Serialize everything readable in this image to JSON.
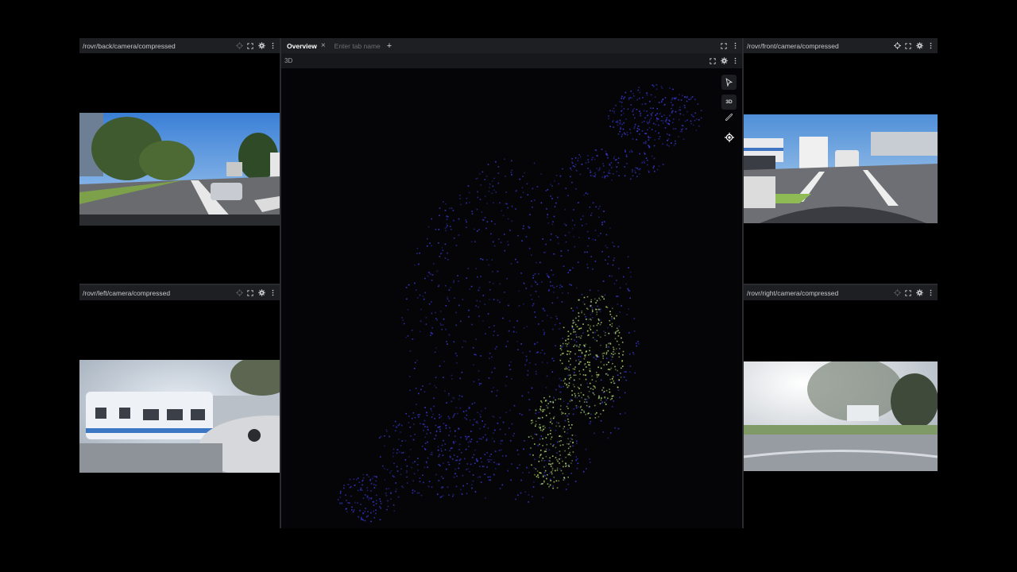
{
  "panels": {
    "back": {
      "title": "/rovr/back/camera/compressed"
    },
    "left": {
      "title": "/rovr/left/camera/compressed"
    },
    "front": {
      "title": "/rovr/front/camera/compressed"
    },
    "right": {
      "title": "/rovr/right/camera/compressed"
    }
  },
  "tabs": {
    "active_label": "Overview",
    "new_tab_placeholder": "Enter tab name",
    "add_label": "+",
    "close_label": "×"
  },
  "scene": {
    "title": "3D",
    "view_mode_label": "3D"
  },
  "icons": [
    "crosshair-icon",
    "fullscreen-icon",
    "gear-icon",
    "more-icon",
    "cursor-icon",
    "ruler-icon",
    "locate-icon"
  ],
  "colors": {
    "toolbar_bg": "#1e1f22",
    "app_bg": "#000000",
    "point_cloud_primary": "#3a3ad8",
    "point_cloud_secondary": "#b8e070"
  }
}
